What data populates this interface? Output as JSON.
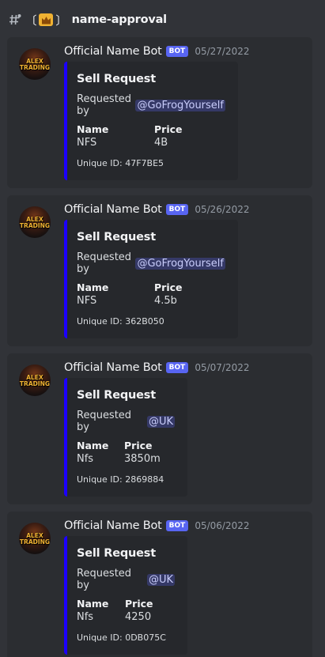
{
  "channel": {
    "name": "name-approval",
    "bracket_open": "〔",
    "bracket_close": "〕"
  },
  "messages": [
    {
      "author": "Official Name Bot",
      "bot_tag": "BOT",
      "timestamp": "05/27/2022",
      "avatar_text_1": "ALEX",
      "avatar_text_2": "TRADING",
      "embed": {
        "title": "Sell Request",
        "desc_prefix": "Requested by",
        "mention": "@GoFrogYourself",
        "field_name_1": "Name",
        "field_value_1": "NFS",
        "field_name_2": "Price",
        "field_value_2": "4B",
        "footer": "Unique ID: 47F7BE5"
      }
    },
    {
      "author": "Official Name Bot",
      "bot_tag": "BOT",
      "timestamp": "05/26/2022",
      "avatar_text_1": "ALEX",
      "avatar_text_2": "TRADING",
      "embed": {
        "title": "Sell Request",
        "desc_prefix": "Requested by",
        "mention": "@GoFrogYourself",
        "field_name_1": "Name",
        "field_value_1": "NFS",
        "field_name_2": "Price",
        "field_value_2": "4.5b",
        "footer": "Unique ID: 362B050"
      }
    },
    {
      "author": "Official Name Bot",
      "bot_tag": "BOT",
      "timestamp": "05/07/2022",
      "avatar_text_1": "ALEX",
      "avatar_text_2": "TRADING",
      "embed": {
        "title": "Sell Request",
        "desc_prefix": "Requested by",
        "mention": "@UK",
        "field_name_1": "Name",
        "field_value_1": "Nfs",
        "field_name_2": "Price",
        "field_value_2": "3850m",
        "footer": "Unique ID: 2869884"
      }
    },
    {
      "author": "Official Name Bot",
      "bot_tag": "BOT",
      "timestamp": "05/06/2022",
      "avatar_text_1": "ALEX",
      "avatar_text_2": "TRADING",
      "embed": {
        "title": "Sell Request",
        "desc_prefix": "Requested by",
        "mention": "@UK",
        "field_name_1": "Name",
        "field_value_1": "Nfs",
        "field_name_2": "Price",
        "field_value_2": "4250",
        "footer": "Unique ID: 0DB075C"
      }
    }
  ],
  "colors": {
    "background": "#313338",
    "message_bg": "#2b2d31",
    "embed_accent": "#1b00ff",
    "bot_tag": "#5865f2",
    "crown": "#f0b232"
  }
}
